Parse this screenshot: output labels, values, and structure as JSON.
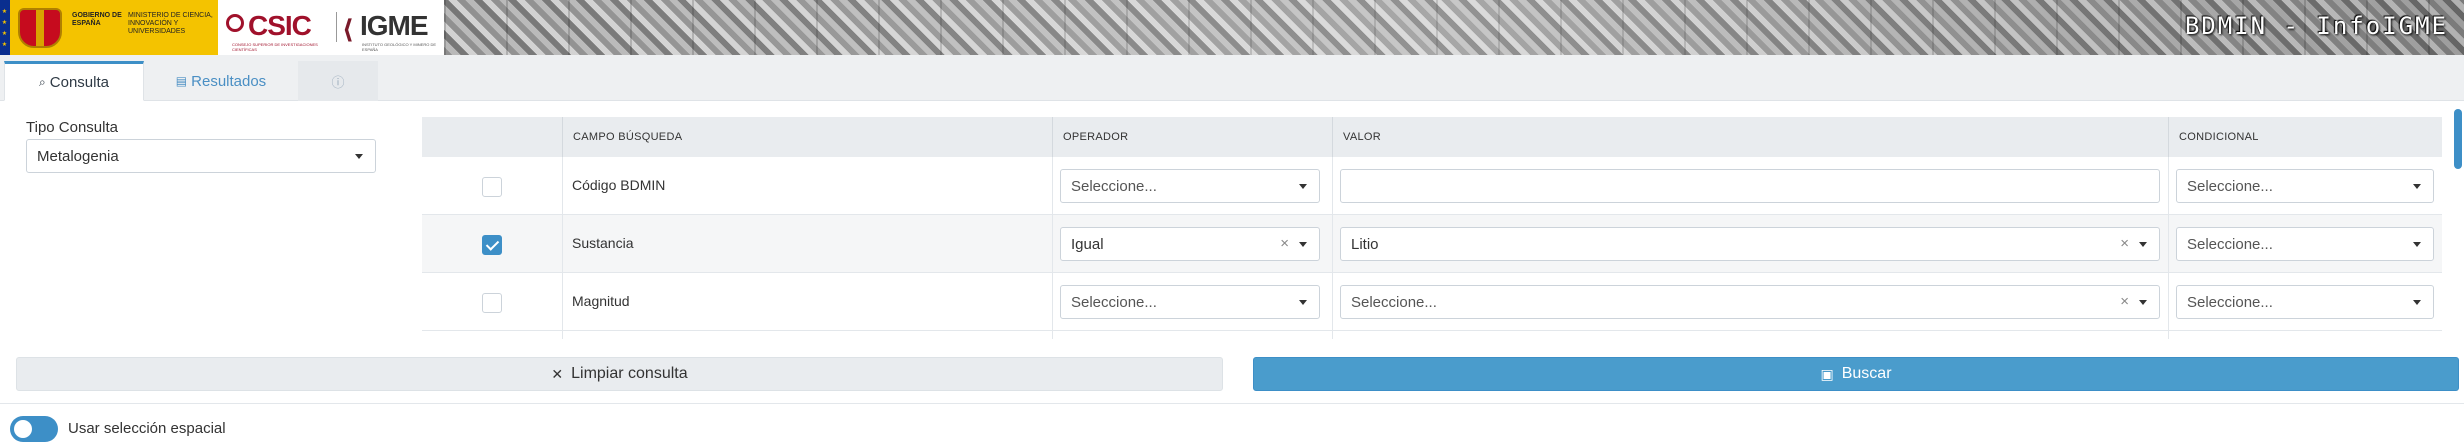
{
  "header": {
    "gov_text": "GOBIERNO DE ESPAÑA",
    "ministry_text": "MINISTERIO DE CIENCIA, INNOVACIÓN Y UNIVERSIDADES",
    "csic": "CSIC",
    "csic_sub": "CONSEJO SUPERIOR DE INVESTIGACIONES CIENTÍFICAS",
    "igme": "IGME",
    "igme_sub": "INSTITUTO GEOLÓGICO Y MINERO DE ESPAÑA",
    "app_title": "BDMIN - InfoIGME"
  },
  "tabs": [
    {
      "label": "Consulta",
      "icon": "search-icon",
      "active": true
    },
    {
      "label": "Resultados",
      "icon": "table-icon",
      "active": false
    },
    {
      "label": "?",
      "icon": "help-icon",
      "active": false
    }
  ],
  "tipo": {
    "label": "Tipo Consulta",
    "value": "Metalogenia"
  },
  "table": {
    "headers": [
      "CAMPO BÚSQUEDA",
      "OPERADOR",
      "VALOR",
      "CONDICIONAL"
    ],
    "rows": [
      {
        "checked": false,
        "campo": "Código BDMIN",
        "operador": "Seleccione...",
        "valor": "",
        "condicional": "Seleccione..."
      },
      {
        "checked": true,
        "campo": "Sustancia",
        "operador": "Igual",
        "valor": "Litio",
        "condicional": "Seleccione..."
      },
      {
        "checked": false,
        "campo": "Magnitud",
        "operador": "Seleccione...",
        "valor": "Seleccione...",
        "condicional": "Seleccione..."
      }
    ]
  },
  "buttons": {
    "clear": "Limpiar consulta",
    "search": "Buscar"
  },
  "spatial": {
    "label": "Usar selección espacial",
    "enabled": true
  },
  "colors": {
    "accent": "#3d8fc7",
    "gov_yellow": "#f4c300",
    "csic_red": "#a0112b"
  }
}
